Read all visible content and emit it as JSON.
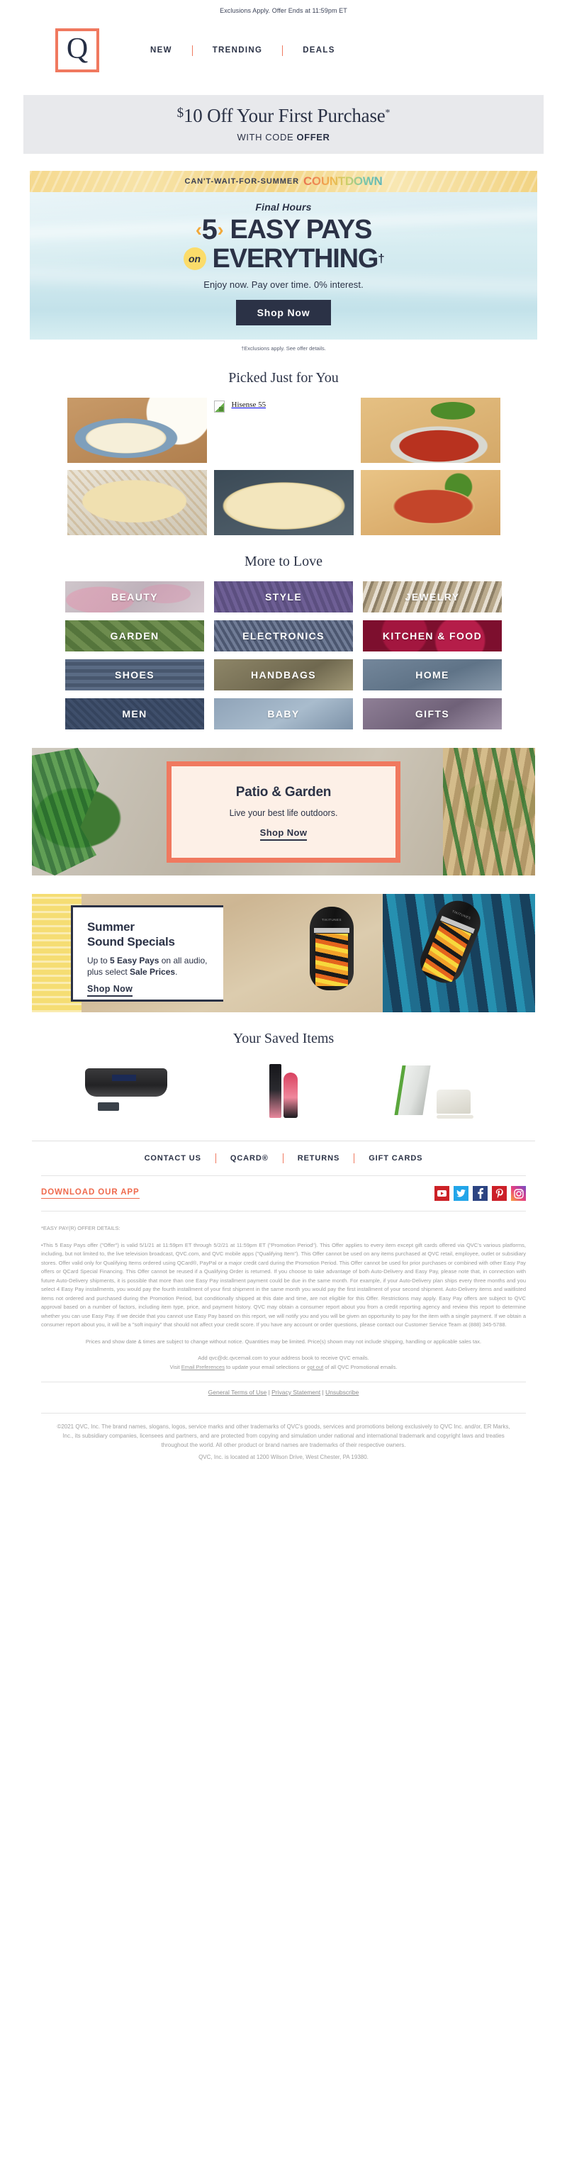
{
  "preheader": "Exclusions Apply. Offer Ends at 11:59pm ET",
  "header": {
    "logo_letter": "Q",
    "nav": [
      {
        "label": "NEW"
      },
      {
        "label": "TRENDING"
      },
      {
        "label": "DEALS"
      }
    ]
  },
  "offer_strip": {
    "dollar": "$",
    "headline": "10 Off Your First Purchase",
    "asterisk": "*",
    "code_prefix": "WITH CODE ",
    "code": "OFFER"
  },
  "hero": {
    "eyebrow_prefix": "CAN'T-WAIT-FOR-SUMMER ",
    "eyebrow_accent": "COUNTDOWN",
    "kicker": "Final Hours",
    "chevron_left": "‹",
    "number": "5",
    "chevron_right": "›",
    "line1": "EASY PAYS",
    "on_bubble": "on",
    "line2": "EVERYTHING",
    "dagger": "†",
    "tagline": "Enjoy now. Pay over time. 0% interest.",
    "cta": "Shop Now",
    "disclaimer": "†Exclusions apply. See offer details."
  },
  "picked": {
    "title": "Picked Just for You",
    "items": [
      {
        "alt": "",
        "kind": "img-pasta-bowl"
      },
      {
        "alt": "Hisense 55",
        "kind": "broken"
      },
      {
        "alt": "",
        "kind": "img-tomato"
      },
      {
        "alt": "",
        "kind": "img-quesadilla"
      },
      {
        "alt": "",
        "kind": "img-mac"
      },
      {
        "alt": "",
        "kind": "img-pizza"
      }
    ]
  },
  "more_to_love": {
    "title": "More to Love",
    "tiles": [
      {
        "label": "BEAUTY",
        "cls": "t-beauty"
      },
      {
        "label": "STYLE",
        "cls": "t-style"
      },
      {
        "label": "JEWELRY",
        "cls": "t-jewelry"
      },
      {
        "label": "GARDEN",
        "cls": "t-garden"
      },
      {
        "label": "ELECTRONICS",
        "cls": "t-elect"
      },
      {
        "label": "KITCHEN & FOOD",
        "cls": "t-kitchen"
      },
      {
        "label": "SHOES",
        "cls": "t-shoes"
      },
      {
        "label": "HANDBAGS",
        "cls": "t-handbags"
      },
      {
        "label": "HOME",
        "cls": "t-home"
      },
      {
        "label": "MEN",
        "cls": "t-men"
      },
      {
        "label": "BABY",
        "cls": "t-baby"
      },
      {
        "label": "GIFTS",
        "cls": "t-gifts"
      }
    ]
  },
  "patio": {
    "title": "Patio & Garden",
    "subtitle": "Live your best life outdoors.",
    "cta": "Shop Now"
  },
  "sound": {
    "title_line1": "Summer",
    "title_line2": "Sound Specials",
    "body_1": "Up to ",
    "body_bold_1": "5 Easy Pays",
    "body_2": " on all audio, plus select ",
    "body_bold_2": "Sale Prices",
    "body_3": ".",
    "cta": "Shop Now",
    "speaker_brand": "TIKITUNES"
  },
  "saved": {
    "title": "Your Saved Items"
  },
  "footer": {
    "nav": [
      {
        "label": "CONTACT US"
      },
      {
        "label": "QCARD®"
      },
      {
        "label": "RETURNS"
      },
      {
        "label": "GIFT CARDS"
      }
    ],
    "app_link": "DOWNLOAD OUR APP",
    "socials": [
      {
        "name": "youtube-icon",
        "cls": "s-yt"
      },
      {
        "name": "twitter-icon",
        "cls": "s-tw"
      },
      {
        "name": "facebook-icon",
        "cls": "s-fb"
      },
      {
        "name": "pinterest-icon",
        "cls": "s-pin"
      },
      {
        "name": "instagram-icon",
        "cls": "s-ig"
      }
    ]
  },
  "legal": {
    "heading": "*EASY PAY(R) OFFER DETAILS:",
    "para1": "•This 5 Easy Pays offer (\"Offer\") is valid 5/1/21 at 11:59pm ET through 5/2/21 at 11:59pm ET (\"Promotion Period\"). This Offer applies to every item except gift cards offered via QVC's various platforms, including, but not limited to, the live television broadcast, QVC.com, and QVC mobile apps (\"Qualifying Item\"). This Offer cannot be used on any items purchased at QVC retail, employee, outlet or subsidiary stores. Offer valid only for Qualifying Items ordered using QCard®, PayPal or a major credit card during the Promotion Period. This Offer cannot be used for prior purchases or combined with other Easy Pay offers or QCard Special Financing. This Offer cannot be reused if a Qualifying Order is returned. If you choose to take advantage of both Auto-Delivery and Easy Pay, please note that, in connection with future Auto-Delivery shipments, it is possible that more than one Easy Pay installment payment could be due in the same month. For example, if your Auto-Delivery plan ships every three months and you select 4 Easy Pay installments, you would pay the fourth installment of your first shipment in the same month you would pay the first installment of your second shipment. Auto-Delivery items and waitlisted items not ordered and purchased during the Promotion Period, but conditionally shipped at this date and time, are not eligible for this Offer. Restrictions may apply. Easy Pay offers are subject to QVC approval based on a number of factors, including item type, price, and payment history. QVC may obtain a consumer report about you from a credit reporting agency and review this report to determine whether you can use Easy Pay. If we decide that you cannot use Easy Pay based on this report, we will notify you and you will be given an opportunity to pay for the item with a single payment. If we obtain a consumer report about you, it will be a \"soft inquiry\" that should not affect your credit score. If you have any account or order questions, please contact our Customer Service Team at (888) 345-5788.",
    "para2": "Prices and show date & times are subject to change without notice. Quantities may be limited. Price(s) shown may not include shipping, handling or applicable sales tax.",
    "para3_a": "Add qvc@dc.qvcemail.com to your address book to receive QVC emails.",
    "para3_b": "Visit ",
    "para3_link1": "Email Preferences",
    "para3_c": " to update your email selections or ",
    "para3_link2": "opt out",
    "para3_d": " of all QVC Promotional emails.",
    "terms": [
      {
        "label": "General Terms of Use"
      },
      {
        "label": "Privacy Statement"
      },
      {
        "label": "Unsubscribe"
      }
    ],
    "copyright": "©2021 QVC, Inc. The brand names, slogans, logos, service marks and other trademarks of QVC's goods, services and promotions belong exclusively to QVC Inc. and/or, ER Marks, Inc., its subsidiary companies, licensees and partners, and are protected from copying and simulation under national and international trademark and copyright laws and treaties throughout the world. All other product or brand names are trademarks of their respective owners.",
    "address": "QVC, Inc. is located at 1200 Wilson Drive, West Chester, PA 19380."
  },
  "colors": {
    "brand_coral": "#f0795f",
    "navy": "#2b3246",
    "strip_gray": "#e8e9ec",
    "yellow": "#fbdc6a",
    "cream": "#fdf0e7"
  }
}
